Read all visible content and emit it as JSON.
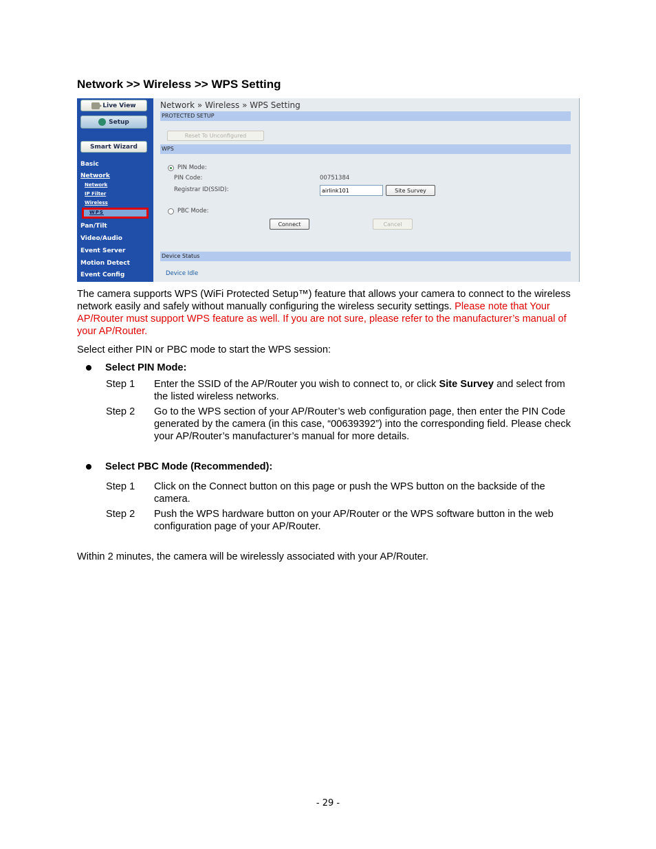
{
  "section_title": "Network >> Wireless >> WPS Setting",
  "screenshot": {
    "sidebar": {
      "live_view": "Live View",
      "setup": "Setup",
      "smart_wizard": "Smart Wizard",
      "basic": "Basic",
      "network": "Network",
      "sub_items": [
        "Network",
        "IP Filter",
        "Wireless",
        "WPS"
      ],
      "sections": [
        "Pan/Tilt",
        "Video/Audio",
        "Event Server",
        "Motion Detect",
        "Event Config"
      ]
    },
    "breadcrumb": "Network » Wireless  » WPS Setting",
    "protected_setup_header": "PROTECTED SETUP",
    "reset_button": "Reset To Unconfigured",
    "wps_header": "WPS",
    "pin_mode_label": "PIN Mode:",
    "pin_code_label": "PIN Code:",
    "pin_code_value": "00751384",
    "registrar_label": "Registrar ID(SSID):",
    "registrar_value": "airlink101",
    "site_survey_button": "Site Survey",
    "pbc_mode_label": "PBC Mode:",
    "connect_button": "Connect",
    "cancel_button": "Cancel",
    "device_status_header": "Device Status",
    "device_status_value": "Device Idle",
    "pin_mode_selected": true
  },
  "intro": {
    "black": "The camera supports WPS (WiFi Protected Setup™) feature that allows your camera to connect to the wireless network easily and safely without manually configuring the wireless security settings. ",
    "red": "Please note that Your AP/Router must support WPS feature as well. If you are not sure, please refer to the manufacturer’s manual of your AP/Router."
  },
  "select_line": "Select either PIN or PBC mode to start the WPS session:",
  "pin_section": {
    "title": "Select PIN Mode:",
    "steps": [
      {
        "label": "Step 1",
        "pre": "Enter the SSID of the AP/Router you wish to connect to, or click ",
        "bold": "Site Survey",
        "post": " and select from the listed wireless networks."
      },
      {
        "label": "Step 2",
        "text": "Go to the WPS section of your AP/Router’s web configuration page, then enter the PIN Code generated by the camera (in this case, “00639392”) into the corresponding field. Please check your AP/Router’s manufacturer’s manual for more details."
      }
    ]
  },
  "pbc_section": {
    "title": "Select PBC Mode (Recommended):",
    "steps": [
      {
        "label": "Step 1",
        "text": "Click on the Connect button on this page or push the WPS button on the backside of the camera."
      },
      {
        "label": "Step 2",
        "text": "Push the WPS hardware button on your AP/Router or the WPS software button in the web configuration page of your AP/Router."
      }
    ]
  },
  "closing": "Within 2 minutes, the camera will be wirelessly associated with your AP/Router.",
  "page_number": "- 29 -",
  "colors": {
    "sidebar_blue": "#1f4fa8",
    "header_bar": "#b3c9ee",
    "highlight_red": "#e00000",
    "content_bg": "#e6ebf0"
  }
}
